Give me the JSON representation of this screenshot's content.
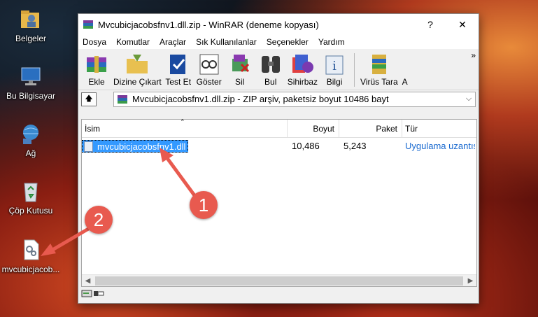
{
  "desktop": {
    "icons": [
      {
        "label": "Belgeler",
        "icon": "folder-user-icon"
      },
      {
        "label": "Bu Bilgisayar",
        "icon": "computer-icon"
      },
      {
        "label": "Ağ",
        "icon": "network-icon"
      },
      {
        "label": "Çöp Kutusu",
        "icon": "recycle-bin-icon"
      },
      {
        "label": "mvcubicjacob...",
        "icon": "dll-file-icon"
      }
    ]
  },
  "window": {
    "title": "Mvcubicjacobsfnv1.dll.zip - WinRAR (deneme kopyası)",
    "help": "?",
    "close": "✕"
  },
  "menu": [
    "Dosya",
    "Komutlar",
    "Araçlar",
    "Sık Kullanılanlar",
    "Seçenekler",
    "Yardım"
  ],
  "toolbar": {
    "items": [
      {
        "label": "Ekle",
        "icon": "add-archive-icon"
      },
      {
        "label": "Dizine Çıkart",
        "icon": "extract-folder-icon"
      },
      {
        "label": "Test Et",
        "icon": "test-icon"
      },
      {
        "label": "Göster",
        "icon": "view-icon"
      },
      {
        "label": "Sil",
        "icon": "delete-icon"
      },
      {
        "label": "Bul",
        "icon": "find-icon"
      },
      {
        "label": "Sihirbaz",
        "icon": "wizard-icon"
      },
      {
        "label": "Bilgi",
        "icon": "info-icon"
      },
      {
        "label": "Virüs Tara",
        "icon": "virus-scan-icon"
      },
      {
        "label": "A",
        "icon": ""
      }
    ],
    "more": "»"
  },
  "address": {
    "text": "Mvcubicjacobsfnv1.dll.zip - ZIP arşiv, paketsiz boyut 10486 bayt"
  },
  "columns": [
    "İsim",
    "Boyut",
    "Paket",
    "Tür"
  ],
  "files": [
    {
      "name": "mvcubicjacobsfnv1.dll",
      "size": "10,486",
      "packed": "5,243",
      "type": "Uygulama uzantısı"
    }
  ],
  "annotations": [
    "1",
    "2"
  ],
  "colors": {
    "selection": "#3399ff",
    "callout": "#e85a4f"
  }
}
